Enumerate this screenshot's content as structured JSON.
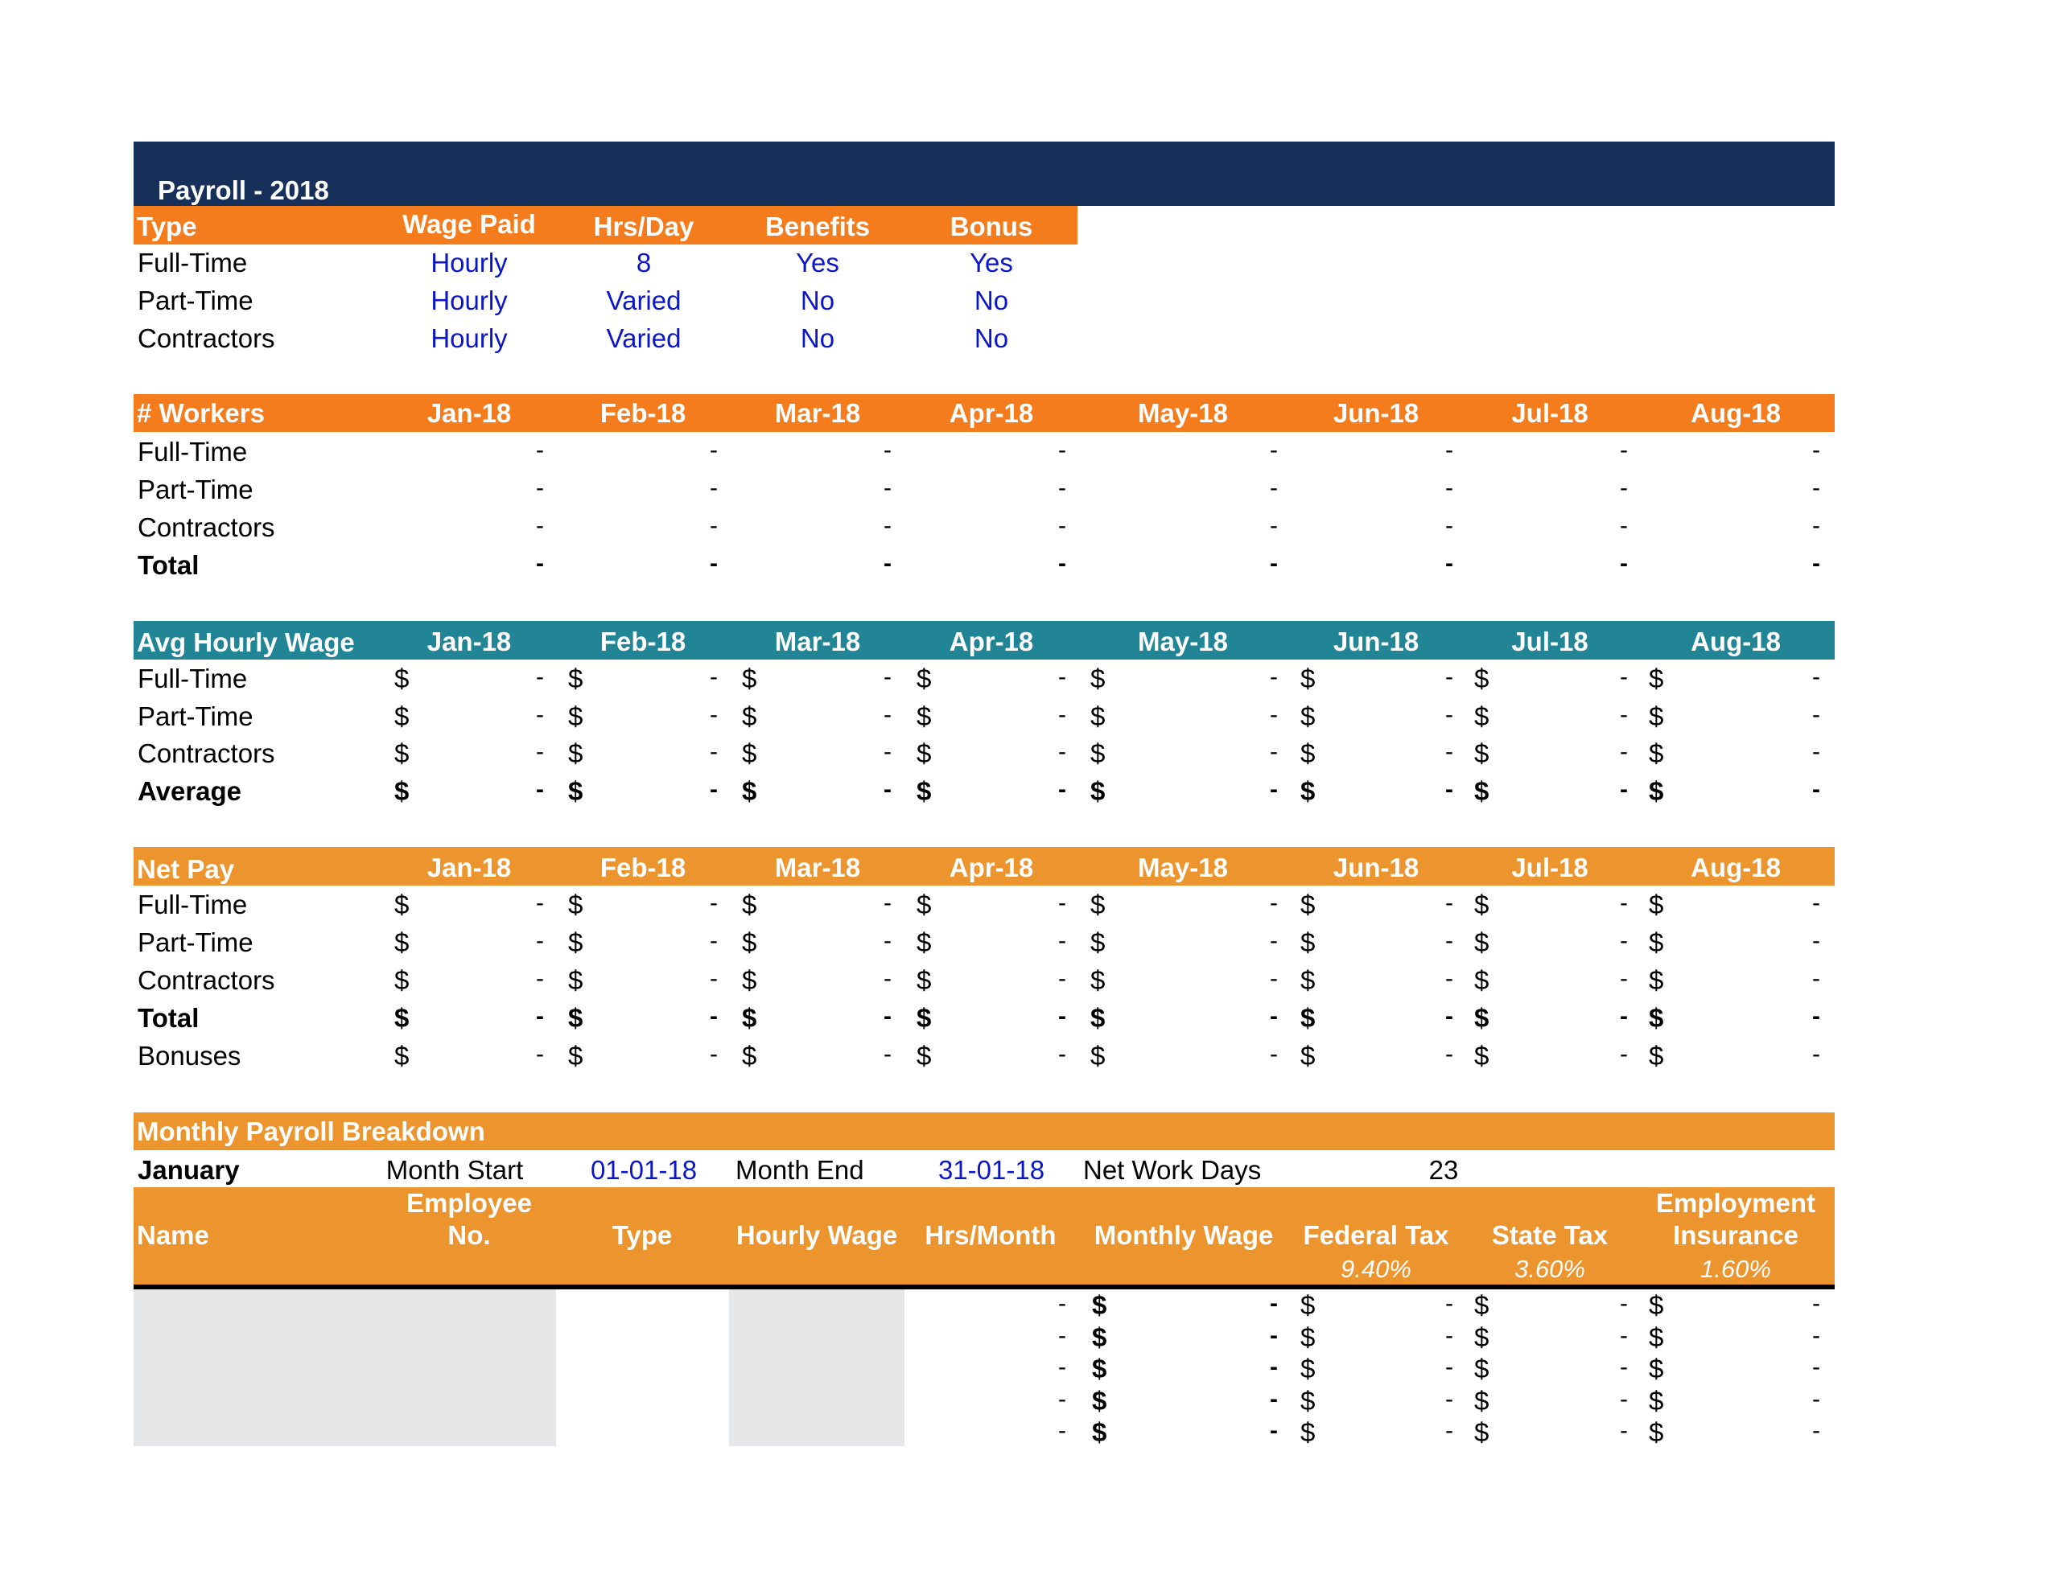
{
  "colors": {
    "title_bar": "#17305a",
    "header_orange": "#f47c1c",
    "header_teal": "#218596",
    "header_soft_orange": "#ec952f",
    "input_blue": "#0b16c8",
    "input_gray": "#e6e7e8"
  },
  "title": "Payroll - 2018",
  "type_table": {
    "headers": [
      "Type",
      "Wage Paid",
      "Hrs/Day",
      "Benefits",
      "Bonus"
    ],
    "rows": [
      {
        "type": "Full-Time",
        "wage_paid": "Hourly",
        "hrs_day": "8",
        "benefits": "Yes",
        "bonus": "Yes"
      },
      {
        "type": "Part-Time",
        "wage_paid": "Hourly",
        "hrs_day": "Varied",
        "benefits": "No",
        "bonus": "No"
      },
      {
        "type": "Contractors",
        "wage_paid": "Hourly",
        "hrs_day": "Varied",
        "benefits": "No",
        "bonus": "No"
      }
    ]
  },
  "months": [
    "Jan-18",
    "Feb-18",
    "Mar-18",
    "Apr-18",
    "May-18",
    "Jun-18",
    "Jul-18",
    "Aug-18"
  ],
  "workers": {
    "title": "# Workers",
    "rows": [
      {
        "label": "Full-Time",
        "bold": false,
        "values": [
          "-",
          "-",
          "-",
          "-",
          "-",
          "-",
          "-",
          "-"
        ]
      },
      {
        "label": "Part-Time",
        "bold": false,
        "values": [
          "-",
          "-",
          "-",
          "-",
          "-",
          "-",
          "-",
          "-"
        ]
      },
      {
        "label": "Contractors",
        "bold": false,
        "values": [
          "-",
          "-",
          "-",
          "-",
          "-",
          "-",
          "-",
          "-"
        ]
      },
      {
        "label": "Total",
        "bold": true,
        "values": [
          "-",
          "-",
          "-",
          "-",
          "-",
          "-",
          "-",
          "-"
        ]
      }
    ]
  },
  "avg_wage": {
    "title": "Avg Hourly Wage",
    "currency": "$",
    "rows": [
      {
        "label": "Full-Time",
        "bold": false,
        "values": [
          "-",
          "-",
          "-",
          "-",
          "-",
          "-",
          "-",
          "-"
        ]
      },
      {
        "label": "Part-Time",
        "bold": false,
        "values": [
          "-",
          "-",
          "-",
          "-",
          "-",
          "-",
          "-",
          "-"
        ]
      },
      {
        "label": "Contractors",
        "bold": false,
        "values": [
          "-",
          "-",
          "-",
          "-",
          "-",
          "-",
          "-",
          "-"
        ]
      },
      {
        "label": "Average",
        "bold": true,
        "values": [
          "-",
          "-",
          "-",
          "-",
          "-",
          "-",
          "-",
          "-"
        ]
      }
    ]
  },
  "net_pay": {
    "title": "Net Pay",
    "currency": "$",
    "rows": [
      {
        "label": "Full-Time",
        "bold": false,
        "values": [
          "-",
          "-",
          "-",
          "-",
          "-",
          "-",
          "-",
          "-"
        ]
      },
      {
        "label": "Part-Time",
        "bold": false,
        "values": [
          "-",
          "-",
          "-",
          "-",
          "-",
          "-",
          "-",
          "-"
        ]
      },
      {
        "label": "Contractors",
        "bold": false,
        "values": [
          "-",
          "-",
          "-",
          "-",
          "-",
          "-",
          "-",
          "-"
        ]
      },
      {
        "label": "Total",
        "bold": true,
        "values": [
          "-",
          "-",
          "-",
          "-",
          "-",
          "-",
          "-",
          "-"
        ]
      },
      {
        "label": "Bonuses",
        "bold": false,
        "values": [
          "-",
          "-",
          "-",
          "-",
          "-",
          "-",
          "-",
          "-"
        ]
      }
    ]
  },
  "breakdown": {
    "title": "Monthly Payroll Breakdown",
    "month": "January",
    "month_start_label": "Month Start",
    "month_start": "01-01-18",
    "month_end_label": "Month End",
    "month_end": "31-01-18",
    "net_work_days_label": "Net Work Days",
    "net_work_days": "23",
    "columns": [
      {
        "line1": "",
        "line2": "Name"
      },
      {
        "line1": "Employee",
        "line2": "No."
      },
      {
        "line1": "",
        "line2": "Type"
      },
      {
        "line1": "",
        "line2": "Hourly Wage"
      },
      {
        "line1": "",
        "line2": "Hrs/Month"
      },
      {
        "line1": "",
        "line2": "Monthly Wage"
      },
      {
        "line1": "",
        "line2": "Federal Tax"
      },
      {
        "line1": "",
        "line2": "State Tax"
      },
      {
        "line1": "Employment",
        "line2": "Insurance"
      }
    ],
    "rates": {
      "federal_tax": "9.40%",
      "state_tax": "3.60%",
      "employment_insurance": "1.60%"
    },
    "currency": "$",
    "rows": [
      {
        "hrs_month": "-",
        "monthly_wage": "-",
        "federal_tax": "-",
        "state_tax": "-",
        "employment_insurance": "-"
      },
      {
        "hrs_month": "-",
        "monthly_wage": "-",
        "federal_tax": "-",
        "state_tax": "-",
        "employment_insurance": "-"
      },
      {
        "hrs_month": "-",
        "monthly_wage": "-",
        "federal_tax": "-",
        "state_tax": "-",
        "employment_insurance": "-"
      },
      {
        "hrs_month": "-",
        "monthly_wage": "-",
        "federal_tax": "-",
        "state_tax": "-",
        "employment_insurance": "-"
      },
      {
        "hrs_month": "-",
        "monthly_wage": "-",
        "federal_tax": "-",
        "state_tax": "-",
        "employment_insurance": "-"
      }
    ]
  }
}
